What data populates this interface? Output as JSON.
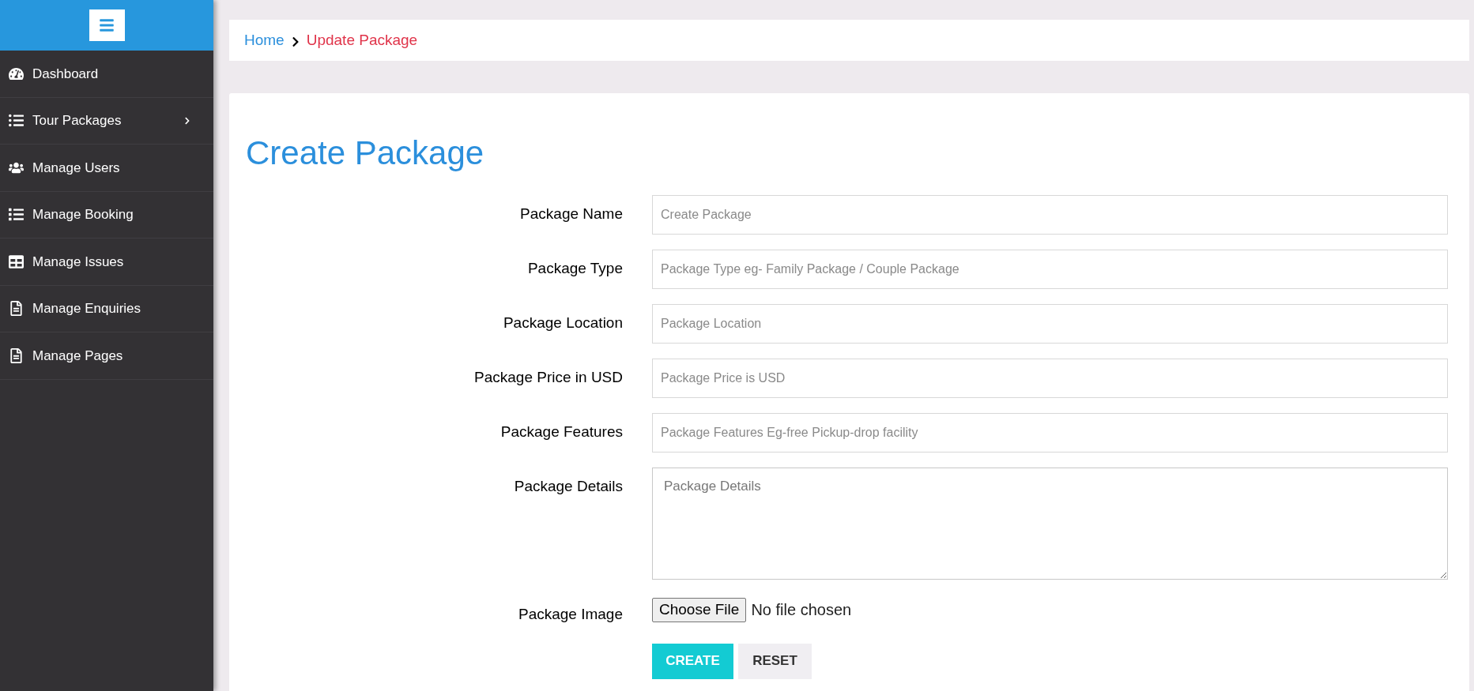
{
  "sidebar": {
    "items": [
      {
        "label": "Dashboard",
        "has_submenu": false
      },
      {
        "label": "Tour Packages",
        "has_submenu": true
      },
      {
        "label": "Manage Users",
        "has_submenu": false
      },
      {
        "label": "Manage Booking",
        "has_submenu": false
      },
      {
        "label": "Manage Issues",
        "has_submenu": false
      },
      {
        "label": "Manage Enquiries",
        "has_submenu": false
      },
      {
        "label": "Manage Pages",
        "has_submenu": false
      }
    ]
  },
  "breadcrumb": {
    "home": "Home",
    "current": "Update Package"
  },
  "form": {
    "title": "Create Package",
    "fields": [
      {
        "kind": "input",
        "label": "Package Name",
        "placeholder": "Create Package"
      },
      {
        "kind": "input",
        "label": "Package Type",
        "placeholder": "Package Type eg- Family Package / Couple Package"
      },
      {
        "kind": "input",
        "label": "Package Location",
        "placeholder": "Package Location"
      },
      {
        "kind": "input",
        "label": "Package Price in USD",
        "placeholder": "Package Price is USD"
      },
      {
        "kind": "input",
        "label": "Package Features",
        "placeholder": "Package Features Eg-free Pickup-drop facility"
      },
      {
        "kind": "textarea",
        "label": "Package Details",
        "placeholder": "Package Details"
      },
      {
        "kind": "file",
        "label": "Package Image",
        "button": "Choose File",
        "status": "No file chosen"
      }
    ],
    "buttons": [
      {
        "label": "CREATE",
        "kind": "primary"
      },
      {
        "label": "RESET",
        "kind": "secondary"
      }
    ]
  }
}
